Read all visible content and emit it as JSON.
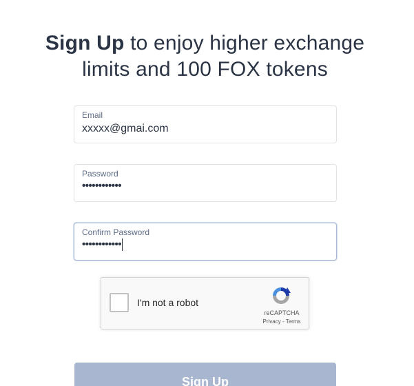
{
  "headline": {
    "strong": "Sign Up",
    "line1_rest": " to enjoy higher exchange",
    "line2": "limits and 100 FOX tokens"
  },
  "form": {
    "email": {
      "label": "Email",
      "value": "xxxxx@gmai.com"
    },
    "password": {
      "label": "Password",
      "value": "••••••••••••"
    },
    "confirm_password": {
      "label": "Confirm Password",
      "value": "••••••••••••"
    }
  },
  "captcha": {
    "label": "I'm not a robot",
    "brand": "reCAPTCHA",
    "privacy": "Privacy",
    "separator": " - ",
    "terms": "Terms",
    "checked": false
  },
  "submit": {
    "label": "Sign Up"
  },
  "colors": {
    "text": "#2b3444",
    "button_disabled": "#a8b7cf",
    "focus_border": "#a9b8d6"
  }
}
